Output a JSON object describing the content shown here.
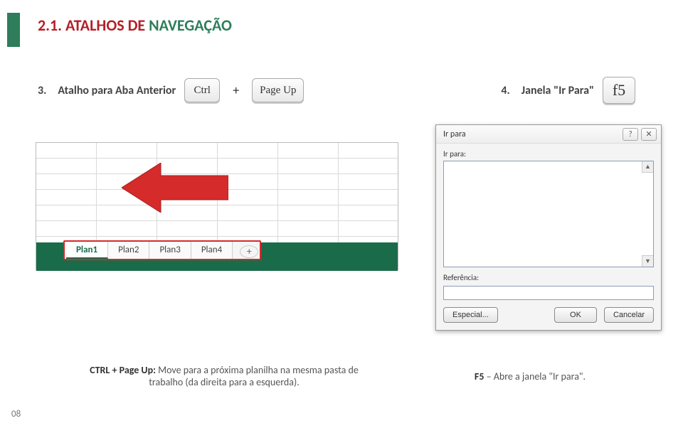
{
  "heading": {
    "prefix": "2.1. ATALHOS DE ",
    "highlight": "NAVEGAÇÃO"
  },
  "shortcut3": {
    "num": "3.",
    "label": "Atalho para Aba Anterior",
    "key1": "Ctrl",
    "plus": "+",
    "key2": "Page Up"
  },
  "shortcut4": {
    "num": "4.",
    "label": "Janela \"Ir Para\"",
    "key": "f5"
  },
  "sheet": {
    "tabs": [
      "Plan1",
      "Plan2",
      "Plan3",
      "Plan4"
    ],
    "activeIndex": 0,
    "add": "+"
  },
  "dialog": {
    "title": "Ir para",
    "listLabel": "Ir para:",
    "refLabel": "Referência:",
    "refValue": "",
    "btnSpecial": "Especial...",
    "btnOk": "OK",
    "btnCancel": "Cancelar"
  },
  "descLeft": {
    "bold": "CTRL + Page Up:",
    "rest": " Move para a próxima planilha na mesma pasta de trabalho (da direita para a esquerda)."
  },
  "descRight": {
    "bold": "F5",
    "rest": " – Abre a janela \"Ir para\"."
  },
  "pageNumber": "08"
}
